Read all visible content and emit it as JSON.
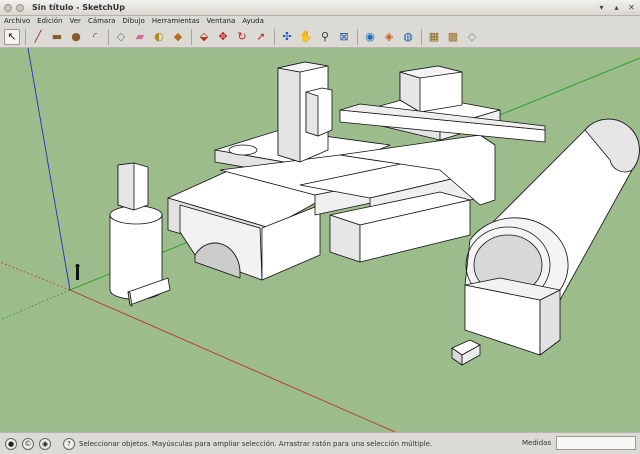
{
  "window": {
    "title": "Sin título - SketchUp"
  },
  "menu": [
    "Archivo",
    "Edición",
    "Ver",
    "Cámara",
    "Dibujo",
    "Herramientas",
    "Ventana",
    "Ayuda"
  ],
  "toolbar": {
    "tools": [
      {
        "name": "select-tool-button",
        "glyph": "↖",
        "color": "#222"
      },
      {
        "sep": true
      },
      {
        "name": "line-tool-button",
        "glyph": "╱",
        "color": "#b01818"
      },
      {
        "name": "rectangle-tool-button",
        "glyph": "▬",
        "color": "#8b5a2b"
      },
      {
        "name": "circle-tool-button",
        "glyph": "●",
        "color": "#8b5a2b"
      },
      {
        "name": "arc-tool-button",
        "glyph": "◜",
        "color": "#444"
      },
      {
        "sep": true
      },
      {
        "name": "make-component-button",
        "glyph": "◇",
        "color": "#777"
      },
      {
        "name": "eraser-tool-button",
        "glyph": "▰",
        "color": "#d46a9a"
      },
      {
        "name": "tape-measure-button",
        "glyph": "◐",
        "color": "#b08a20"
      },
      {
        "name": "paint-bucket-button",
        "glyph": "◆",
        "color": "#b07020"
      },
      {
        "sep": true
      },
      {
        "name": "push-pull-button",
        "glyph": "⬙",
        "color": "#b03018"
      },
      {
        "name": "move-tool-button",
        "glyph": "✥",
        "color": "#c02020"
      },
      {
        "name": "rotate-tool-button",
        "glyph": "↻",
        "color": "#c02020"
      },
      {
        "name": "follow-me-button",
        "glyph": "➚",
        "color": "#c02020"
      },
      {
        "sep": true
      },
      {
        "name": "orbit-tool-button",
        "glyph": "✣",
        "color": "#2050c0"
      },
      {
        "name": "pan-tool-button",
        "glyph": "✋",
        "color": "#2060a0"
      },
      {
        "name": "zoom-tool-button",
        "glyph": "⚲",
        "color": "#333"
      },
      {
        "name": "zoom-extents-button",
        "glyph": "⊠",
        "color": "#2050a0"
      },
      {
        "sep": true
      },
      {
        "name": "get-models-button",
        "glyph": "◉",
        "color": "#2070c0"
      },
      {
        "name": "share-model-button",
        "glyph": "◈",
        "color": "#c06020"
      },
      {
        "name": "google-earth-button",
        "glyph": "◍",
        "color": "#1a60b0"
      },
      {
        "sep": true
      },
      {
        "name": "components-browser-button",
        "glyph": "▦",
        "color": "#8a6a20"
      },
      {
        "name": "materials-browser-button",
        "glyph": "▩",
        "color": "#a07030"
      },
      {
        "name": "styles-browser-button",
        "glyph": "◇",
        "color": "#888"
      }
    ]
  },
  "colors": {
    "viewport_bg": "#9cbc8c",
    "axis_red": "#c0302a",
    "axis_green": "#20a020",
    "axis_blue": "#2030c0",
    "face": "#ffffff",
    "face_shade": "#dcdcdc"
  },
  "status": {
    "message": "Seleccionar objetos. Mayúsculas para ampliar selección. Arrastrar ratón para una selección múltiple.",
    "measure_label": "Medidas",
    "measure_value": ""
  }
}
